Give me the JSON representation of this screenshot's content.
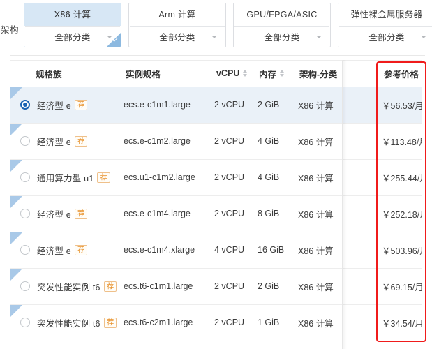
{
  "arch_filter": {
    "label": "架构",
    "cards": [
      {
        "title": "X86 计算",
        "category": "全部分类",
        "selected": true
      },
      {
        "title": "Arm 计算",
        "category": "全部分类",
        "selected": false
      },
      {
        "title": "GPU/FPGA/ASIC",
        "category": "全部分类",
        "selected": false
      },
      {
        "title": "弹性裸金属服务器",
        "category": "全部分类",
        "selected": false
      }
    ]
  },
  "table": {
    "columns": [
      {
        "key": "family",
        "label": "规格族",
        "sortable": false
      },
      {
        "key": "spec",
        "label": "实例规格",
        "sortable": false
      },
      {
        "key": "vcpu",
        "label": "vCPU",
        "sortable": true
      },
      {
        "key": "memory",
        "label": "内存",
        "sortable": true
      },
      {
        "key": "arch",
        "label": "架构-分类",
        "sortable": false
      },
      {
        "key": "price",
        "label": "参考价格",
        "sortable": true
      }
    ],
    "badge_label": "荐",
    "rows": [
      {
        "selected": true,
        "family": "经济型 e",
        "badge": "荐",
        "spec": "ecs.e-c1m1.large",
        "vcpu": "2 vCPU",
        "memory": "2 GiB",
        "arch": "X86 计算",
        "price_amount": "￥56.53",
        "price_unit": "/月"
      },
      {
        "selected": false,
        "family": "经济型 e",
        "badge": "荐",
        "spec": "ecs.e-c1m2.large",
        "vcpu": "2 vCPU",
        "memory": "4 GiB",
        "arch": "X86 计算",
        "price_amount": "￥113.48",
        "price_unit": "/月"
      },
      {
        "selected": false,
        "family": "通用算力型 u1",
        "badge": "荐",
        "spec": "ecs.u1-c1m2.large",
        "vcpu": "2 vCPU",
        "memory": "4 GiB",
        "arch": "X86 计算",
        "price_amount": "￥255.44",
        "price_unit": "/月"
      },
      {
        "selected": false,
        "family": "经济型 e",
        "badge": "荐",
        "spec": "ecs.e-c1m4.large",
        "vcpu": "2 vCPU",
        "memory": "8 GiB",
        "arch": "X86 计算",
        "price_amount": "￥252.18",
        "price_unit": "/月"
      },
      {
        "selected": false,
        "family": "经济型 e",
        "badge": "荐",
        "spec": "ecs.e-c1m4.xlarge",
        "vcpu": "4 vCPU",
        "memory": "16 GiB",
        "arch": "X86 计算",
        "price_amount": "￥503.96",
        "price_unit": "/月"
      },
      {
        "selected": false,
        "family": "突发性能实例 t6",
        "badge": "荐",
        "spec": "ecs.t6-c1m1.large",
        "vcpu": "2 vCPU",
        "memory": "2 GiB",
        "arch": "X86 计算",
        "price_amount": "￥69.15",
        "price_unit": "/月"
      },
      {
        "selected": false,
        "family": "突发性能实例 t6",
        "badge": "荐",
        "spec": "ecs.t6-c2m1.large",
        "vcpu": "2 vCPU",
        "memory": "1 GiB",
        "arch": "X86 计算",
        "price_amount": "￥34.54",
        "price_unit": "/月"
      }
    ]
  },
  "annotation": {
    "highlight_color": "#f01b1b",
    "highlight_target": "参考价格"
  },
  "colors": {
    "accent_blue": "#1a64b4",
    "selected_row": "#eaf1f8",
    "card_selected": "#d7e7f5",
    "price_orange": "#e8903a",
    "badge_orange": "#e8922c"
  }
}
